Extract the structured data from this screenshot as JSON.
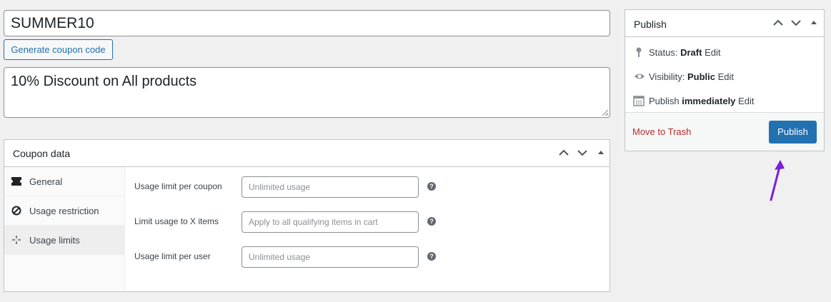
{
  "coupon": {
    "code": "SUMMER10",
    "generate_label": "Generate coupon code",
    "description": "10% Discount on All products"
  },
  "coupon_data": {
    "title": "Coupon data",
    "tabs": [
      {
        "label": "General",
        "icon": "ticket-icon"
      },
      {
        "label": "Usage restriction",
        "icon": "block-icon"
      },
      {
        "label": "Usage limits",
        "icon": "crosshair-icon",
        "active": true
      }
    ],
    "fields": [
      {
        "label": "Usage limit per coupon",
        "placeholder": "Unlimited usage"
      },
      {
        "label": "Limit usage to X items",
        "placeholder": "Apply to all qualifying items in cart"
      },
      {
        "label": "Usage limit per user",
        "placeholder": "Unlimited usage"
      }
    ],
    "help_glyph": "?"
  },
  "publish": {
    "title": "Publish",
    "status_label": "Status:",
    "status_value": "Draft",
    "visibility_label": "Visibility:",
    "visibility_value": "Public",
    "schedule_label": "Publish",
    "schedule_value": "immediately",
    "edit_label": "Edit",
    "trash_label": "Move to Trash",
    "publish_button": "Publish"
  },
  "colors": {
    "accent": "#2271b1",
    "danger": "#b32d2e",
    "annotation_arrow": "#7b1fd8",
    "background": "#f0f0f1"
  }
}
